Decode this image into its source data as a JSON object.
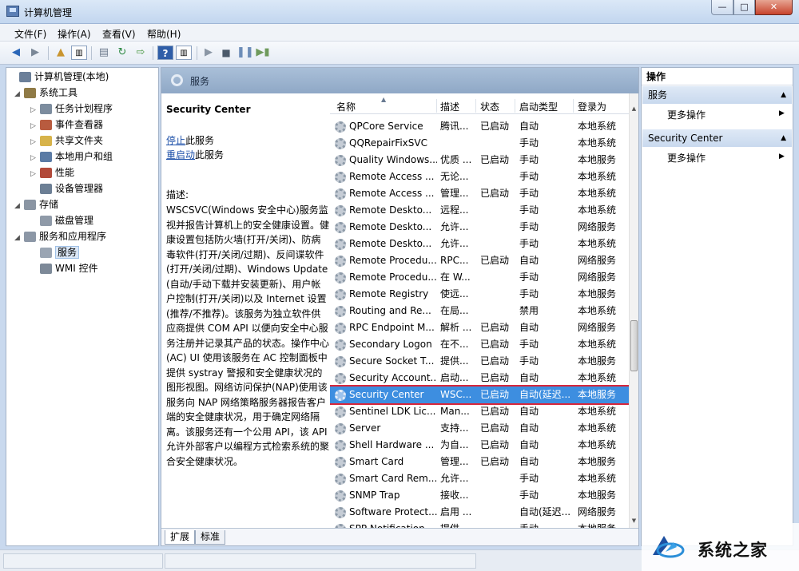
{
  "window": {
    "title": "计算机管理",
    "min": "—",
    "max": "□",
    "close": "✕"
  },
  "menu": [
    "文件(F)",
    "操作(A)",
    "查看(V)",
    "帮助(H)"
  ],
  "tree": [
    {
      "label": "计算机管理(本地)",
      "icon": "computer-management-icon",
      "color": "#6b7f99",
      "level": 0,
      "exp": ""
    },
    {
      "label": "系统工具",
      "icon": "system-tools-icon",
      "color": "#8f7a46",
      "level": 1,
      "exp": "◢"
    },
    {
      "label": "任务计划程序",
      "icon": "task-scheduler-icon",
      "color": "#7c8c9e",
      "level": 2,
      "exp": "▷"
    },
    {
      "label": "事件查看器",
      "icon": "event-viewer-icon",
      "color": "#b85b3f",
      "level": 2,
      "exp": "▷"
    },
    {
      "label": "共享文件夹",
      "icon": "shared-folders-icon",
      "color": "#d7b34a",
      "level": 2,
      "exp": "▷"
    },
    {
      "label": "本地用户和组",
      "icon": "users-groups-icon",
      "color": "#5a7ba5",
      "level": 2,
      "exp": "▷"
    },
    {
      "label": "性能",
      "icon": "performance-icon",
      "color": "#b24a3a",
      "level": 2,
      "exp": "▷"
    },
    {
      "label": "设备管理器",
      "icon": "device-manager-icon",
      "color": "#6c7f95",
      "level": 2,
      "exp": ""
    },
    {
      "label": "存储",
      "icon": "storage-icon",
      "color": "#8a95a3",
      "level": 1,
      "exp": "◢"
    },
    {
      "label": "磁盘管理",
      "icon": "disk-management-icon",
      "color": "#8f9aa8",
      "level": 2,
      "exp": ""
    },
    {
      "label": "服务和应用程序",
      "icon": "services-applications-icon",
      "color": "#8c97a6",
      "level": 1,
      "exp": "◢"
    },
    {
      "label": "服务",
      "icon": "services-icon",
      "color": "#9aa5b3",
      "level": 2,
      "exp": "",
      "selected": true
    },
    {
      "label": "WMI 控件",
      "icon": "wmi-control-icon",
      "color": "#7d8998",
      "level": 2,
      "exp": ""
    }
  ],
  "center": {
    "header": "服务",
    "service_name": "Security Center",
    "stop_link": "停止",
    "stop_suffix": "此服务",
    "restart_link": "重启动",
    "restart_suffix": "此服务",
    "desc_label": "描述:",
    "description": "WSCSVC(Windows 安全中心)服务监视并报告计算机上的安全健康设置。健康设置包括防火墙(打开/关闭)、防病毒软件(打开/关闭/过期)、反间谍软件(打开/关闭/过期)、Windows Update(自动/手动下载并安装更新)、用户帐户控制(打开/关闭)以及 Internet 设置(推荐/不推荐)。该服务为独立软件供应商提供 COM API 以便向安全中心服务注册并记录其产品的状态。操作中心(AC) UI 使用该服务在 AC 控制面板中提供 systray 警报和安全健康状况的图形视图。网络访问保护(NAP)使用该服务向 NAP 网络策略服务器报告客户端的安全健康状况，用于确定网络隔离。该服务还有一个公用 API，该 API 允许外部客户以编程方式检索系统的聚合安全健康状况。"
  },
  "columns": [
    "名称",
    "描述",
    "状态",
    "启动类型",
    "登录为"
  ],
  "rows": [
    [
      "QPCore Service",
      "腾讯...",
      "已启动",
      "自动",
      "本地系统"
    ],
    [
      "QQRepairFixSVC",
      "",
      "",
      "手动",
      "本地系统"
    ],
    [
      "Quality Windows...",
      "优质 ...",
      "已启动",
      "手动",
      "本地服务"
    ],
    [
      "Remote Access ...",
      "无论...",
      "",
      "手动",
      "本地系统"
    ],
    [
      "Remote Access ...",
      "管理...",
      "已启动",
      "手动",
      "本地系统"
    ],
    [
      "Remote Deskto...",
      "远程...",
      "",
      "手动",
      "本地系统"
    ],
    [
      "Remote Deskto...",
      "允许...",
      "",
      "手动",
      "网络服务"
    ],
    [
      "Remote Deskto...",
      "允许...",
      "",
      "手动",
      "本地系统"
    ],
    [
      "Remote Procedu...",
      "RPC...",
      "已启动",
      "自动",
      "网络服务"
    ],
    [
      "Remote Procedu...",
      "在 W...",
      "",
      "手动",
      "网络服务"
    ],
    [
      "Remote Registry",
      "使远...",
      "",
      "手动",
      "本地服务"
    ],
    [
      "Routing and Re...",
      "在局...",
      "",
      "禁用",
      "本地系统"
    ],
    [
      "RPC Endpoint M...",
      "解析 ...",
      "已启动",
      "自动",
      "网络服务"
    ],
    [
      "Secondary Logon",
      "在不...",
      "已启动",
      "手动",
      "本地系统"
    ],
    [
      "Secure Socket T...",
      "提供...",
      "已启动",
      "手动",
      "本地服务"
    ],
    [
      "Security Account...",
      "启动...",
      "已启动",
      "自动",
      "本地系统"
    ],
    [
      "Security Center",
      "WSC...",
      "已启动",
      "自动(延迟...",
      "本地服务"
    ],
    [
      "Sentinel LDK Lic...",
      "Man...",
      "已启动",
      "自动",
      "本地系统"
    ],
    [
      "Server",
      "支持...",
      "已启动",
      "自动",
      "本地系统"
    ],
    [
      "Shell Hardware ...",
      "为自...",
      "已启动",
      "自动",
      "本地系统"
    ],
    [
      "Smart Card",
      "管理...",
      "已启动",
      "自动",
      "本地服务"
    ],
    [
      "Smart Card Rem...",
      "允许...",
      "",
      "手动",
      "本地系统"
    ],
    [
      "SNMP Trap",
      "接收...",
      "",
      "手动",
      "本地服务"
    ],
    [
      "Software Protect...",
      "启用 ...",
      "",
      "自动(延迟...",
      "网络服务"
    ],
    [
      "SPP Notification...",
      "提供...",
      "",
      "手动",
      "本地服务"
    ]
  ],
  "selected_row": 16,
  "tabs": [
    "扩展",
    "标准"
  ],
  "actions": {
    "title": "操作",
    "sections": [
      {
        "header": "服务",
        "item": "更多操作"
      },
      {
        "header": "Security Center",
        "item": "更多操作"
      }
    ]
  },
  "watermark": "系统之家",
  "colors": {
    "selection": "#3d8ee0",
    "highlight_border": "#d8263a",
    "link": "#1c4fa8"
  }
}
